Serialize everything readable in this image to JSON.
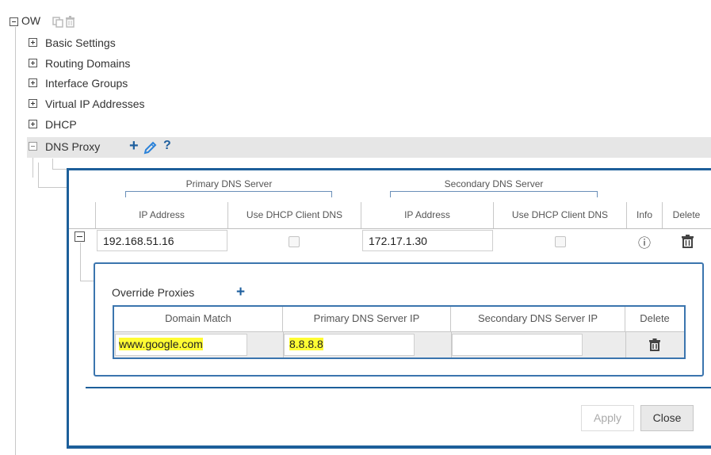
{
  "tree": {
    "root_label": "OW",
    "items": [
      {
        "label": "Basic Settings"
      },
      {
        "label": "Routing Domains"
      },
      {
        "label": "Interface Groups"
      },
      {
        "label": "Virtual IP Addresses"
      },
      {
        "label": "DHCP"
      }
    ],
    "active": {
      "label": "DNS Proxy",
      "add_glyph": "+",
      "help_glyph": "?"
    }
  },
  "dns_table": {
    "group_primary": "Primary DNS Server",
    "group_secondary": "Secondary DNS Server",
    "columns": [
      "IP Address",
      "Use DHCP Client DNS",
      "IP Address",
      "Use DHCP Client DNS",
      "Info",
      "Delete"
    ],
    "row": {
      "primary_ip": "192.168.51.16",
      "primary_use_dhcp": false,
      "secondary_ip": "172.17.1.30",
      "secondary_use_dhcp": false,
      "info_glyph": "ⓘ"
    }
  },
  "override": {
    "title": "Override Proxies",
    "add_glyph": "+",
    "columns": [
      "Domain Match",
      "Primary DNS Server IP",
      "Secondary DNS Server IP",
      "Delete"
    ],
    "row": {
      "domain": "www.google.com",
      "primary_ip": "8.8.8.8",
      "secondary_ip": ""
    }
  },
  "buttons": {
    "apply": "Apply",
    "close": "Close"
  },
  "colors": {
    "accent": "#1d5f9a",
    "highlight": "#fffc33",
    "active_row": "#e6e6e6"
  }
}
